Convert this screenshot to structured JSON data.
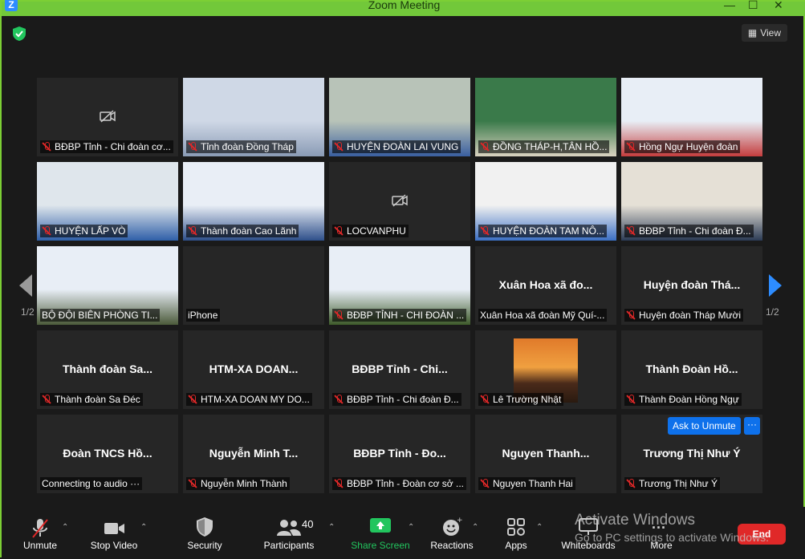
{
  "window": {
    "title": "Zoom Meeting"
  },
  "top": {
    "view_label": "View"
  },
  "pagination": {
    "left": "1/2",
    "right": "1/2"
  },
  "tiles": [
    {
      "label": "BĐBP Tỉnh - Chi đoàn cơ...",
      "big_name": "",
      "camera_off": true,
      "has_video": false
    },
    {
      "label": "Tỉnh đoàn Đồng Tháp",
      "big_name": "",
      "has_video": true
    },
    {
      "label": "HUYỆN ĐOÀN LAI VUNG",
      "big_name": "",
      "has_video": true
    },
    {
      "label": "ĐỒNG THÁP-H,TÂN HỒ...",
      "big_name": "",
      "has_video": true
    },
    {
      "label": "Hồng Ngự Huyện đoàn",
      "big_name": "",
      "has_video": true
    },
    {
      "label": "HUYỆN LẤP VÒ",
      "big_name": "",
      "has_video": true
    },
    {
      "label": "Thành đoàn Cao Lãnh",
      "big_name": "",
      "has_video": true
    },
    {
      "label": "LOCVANPHU",
      "big_name": "",
      "camera_off": true,
      "has_video": false
    },
    {
      "label": "HUYỆN ĐOÀN TAM NÔ...",
      "big_name": "",
      "has_video": true
    },
    {
      "label": "BĐBP Tỉnh - Chi đoàn Đ...",
      "big_name": "",
      "has_video": true
    },
    {
      "label": "BỘ ĐỘI BIÊN PHÒNG TI...",
      "big_name": "",
      "has_video": true,
      "unmuted": true
    },
    {
      "label": "iPhone",
      "big_name": "",
      "has_video": false,
      "unmuted": true
    },
    {
      "label": "BĐBP TỈNH - CHI ĐOÀN ...",
      "big_name": "",
      "has_video": true
    },
    {
      "label": "Xuân Hoa xã đoàn Mỹ Quí-...",
      "big_name": "Xuân Hoa xã đo...",
      "has_video": false,
      "unmuted": true
    },
    {
      "label": "Huyện đoàn Tháp Mười",
      "big_name": "Huyện đoàn Thá...",
      "has_video": false
    },
    {
      "label": "Thành đoàn Sa Đéc",
      "big_name": "Thành đoàn Sa...",
      "has_video": false
    },
    {
      "label": "HTM-XA DOAN MY DO...",
      "big_name": "HTM-XA DOAN...",
      "has_video": false
    },
    {
      "label": "BĐBP Tỉnh - Chi đoàn Đ...",
      "big_name": "BĐBP Tỉnh - Chi...",
      "has_video": false
    },
    {
      "label": "Lê Trường Nhật",
      "big_name": "",
      "has_avatar": true,
      "has_video": false
    },
    {
      "label": "Thành Đoàn Hồng Ngự",
      "big_name": "Thành Đoàn Hồ...",
      "has_video": false
    },
    {
      "label": "Connecting to audio ···",
      "big_name": "Đoàn TNCS Hồ...",
      "has_video": false,
      "unmuted": true
    },
    {
      "label": "Nguyễn Minh Thành",
      "big_name": "Nguyễn Minh T...",
      "has_video": false
    },
    {
      "label": "BĐBP Tỉnh - Đoàn cơ sở ...",
      "big_name": "BĐBP Tỉnh - Đo...",
      "has_video": false
    },
    {
      "label": "Nguyen Thanh Hai",
      "big_name": "Nguyen  Thanh...",
      "has_video": false
    },
    {
      "label": "Trương Thị Như Ý",
      "big_name": "Trương Thị Như Ý",
      "has_video": false
    }
  ],
  "ask_unmute": {
    "label": "Ask to Unmute",
    "more": "···"
  },
  "toolbar": {
    "unmute": "Unmute",
    "stop_video": "Stop Video",
    "security": "Security",
    "participants": "Participants",
    "participants_count": "40",
    "share_screen": "Share Screen",
    "reactions": "Reactions",
    "apps": "Apps",
    "whiteboards": "Whiteboards",
    "more": "More",
    "end": "End"
  },
  "watermark": {
    "line1": "Activate Windows",
    "line2": "Go to PC settings to activate Windows."
  },
  "colors": {
    "accent": "#2d8cff",
    "share_green": "#22c55e",
    "end_red": "#e02828",
    "window_border": "#7ccf35"
  }
}
